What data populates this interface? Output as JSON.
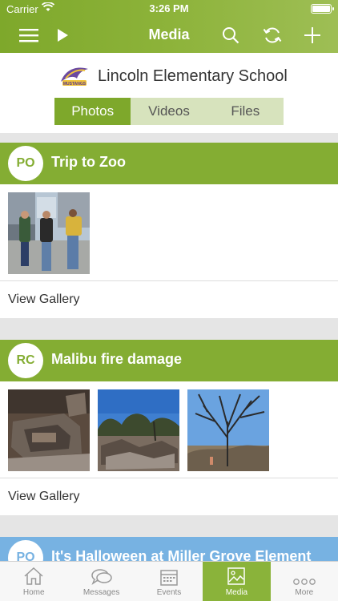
{
  "status": {
    "carrier": "Carrier",
    "time": "3:26 PM"
  },
  "nav": {
    "title": "Media"
  },
  "school": {
    "name": "Lincoln Elementary School",
    "logo_text": "MUSTANGS"
  },
  "segments": [
    {
      "label": "Photos",
      "active": true
    },
    {
      "label": "Videos",
      "active": false
    },
    {
      "label": "Files",
      "active": false
    }
  ],
  "albums": [
    {
      "initials": "PO",
      "title": "Trip to Zoo",
      "gallery_label": "View Gallery",
      "photo_count": 1
    },
    {
      "initials": "RC",
      "title": "Malibu fire damage",
      "gallery_label": "View Gallery",
      "photo_count": 3
    },
    {
      "initials": "PO",
      "title": "It's Halloween at Miller Grove Element"
    }
  ],
  "tabs": [
    {
      "label": "Home",
      "icon": "home-icon"
    },
    {
      "label": "Messages",
      "icon": "messages-icon"
    },
    {
      "label": "Events",
      "icon": "calendar-icon"
    },
    {
      "label": "Media",
      "icon": "image-icon",
      "active": true
    },
    {
      "label": "More",
      "icon": "more-icon"
    }
  ],
  "colors": {
    "accent": "#84ad33",
    "accent_light": "#d7e3bd",
    "blue_header": "#77b2e2"
  }
}
